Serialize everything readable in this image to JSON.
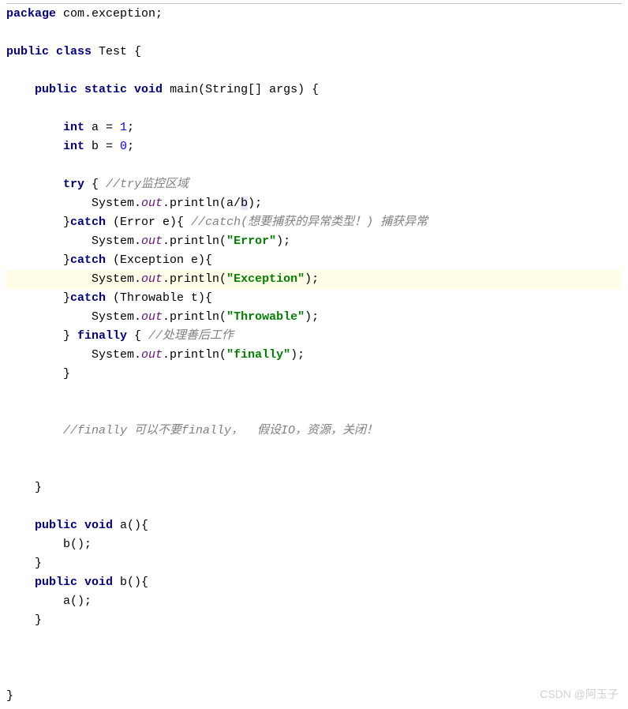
{
  "code": {
    "line1": {
      "kw_package": "package",
      "pkg_name": " com.exception;"
    },
    "line3": {
      "kw_public": "public",
      "kw_class": " class",
      "class_name": " Test {"
    },
    "line5": {
      "indent": "    ",
      "kw_public": "public",
      "kw_static": " static",
      "kw_void": " void",
      "method": " main(String[] args) {"
    },
    "line7": {
      "indent": "        ",
      "kw_int": "int",
      "text": " a = ",
      "num": "1",
      "semi": ";"
    },
    "line8": {
      "indent": "        ",
      "kw_int": "int",
      "text": " b = ",
      "num": "0",
      "semi": ";"
    },
    "line10": {
      "indent": "        ",
      "kw_try": "try",
      "brace": " { ",
      "comment": "//try监控区域"
    },
    "line11": {
      "indent": "            System.",
      "out": "out",
      "rest": ".println(a/",
      "b_hl": "b",
      "end": ");"
    },
    "line12": {
      "indent": "        }",
      "kw_catch": "catch",
      "params": " (Error e){ ",
      "comment": "//catch(想要捕获的异常类型！) 捕获异常"
    },
    "line13": {
      "indent": "            System.",
      "out": "out",
      "rest": ".println(",
      "str": "\"Error\"",
      "end": ");"
    },
    "line14": {
      "indent": "        }",
      "kw_catch": "catch",
      "params": " (Exception e){"
    },
    "line15": {
      "indent": "            System.",
      "out": "out",
      "rest": ".println(",
      "str": "\"Exception\"",
      "end": ");"
    },
    "line16": {
      "indent": "        }",
      "kw_catch": "catch",
      "params": " (Throwable t){"
    },
    "line17": {
      "indent": "            System.",
      "out": "out",
      "rest": ".println(",
      "str": "\"Throwable\"",
      "end": ");"
    },
    "line18": {
      "indent": "        } ",
      "kw_finally": "finally",
      "brace": " { ",
      "comment": "//处理善后工作"
    },
    "line19": {
      "indent": "            System.",
      "out": "out",
      "rest": ".println(",
      "str": "\"finally\"",
      "end": ");"
    },
    "line20": {
      "text": "        }"
    },
    "line23": {
      "indent": "        ",
      "comment": "//finally 可以不要finally，  假设IO，资源，关闭！"
    },
    "line26": {
      "text": "    }"
    },
    "line28": {
      "indent": "    ",
      "kw_public": "public",
      "kw_void": " void",
      "method": " a(){"
    },
    "line29": {
      "text": "        b();"
    },
    "line30": {
      "text": "    }"
    },
    "line31": {
      "indent": "    ",
      "kw_public": "public",
      "kw_void": " void",
      "method": " b(){"
    },
    "line32": {
      "text": "        a();"
    },
    "line33": {
      "text": "    }"
    },
    "line37": {
      "text": "}"
    }
  },
  "watermark": "CSDN @阿玉子"
}
